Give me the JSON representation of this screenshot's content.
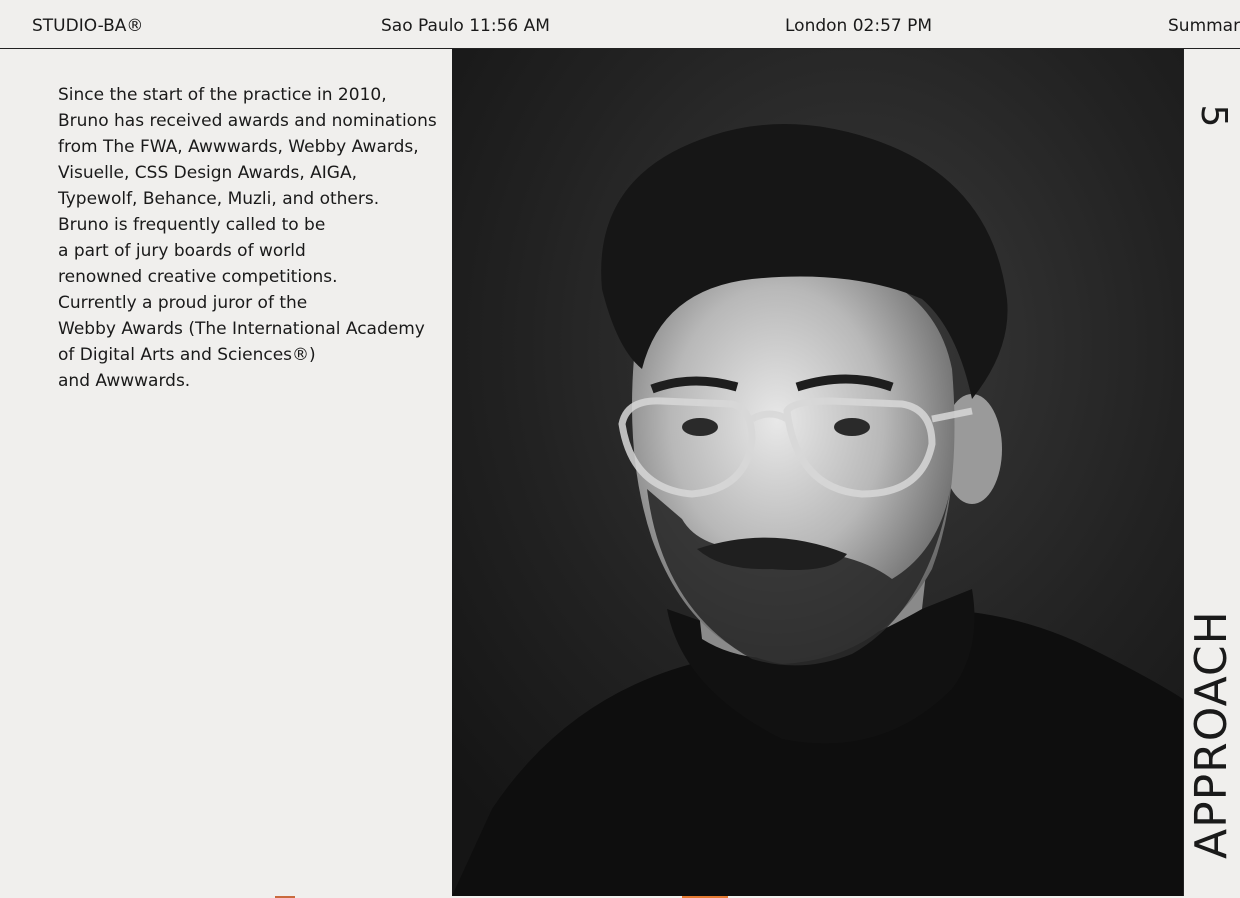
{
  "header": {
    "logo": "STUDIO-BA®",
    "city1": "Sao Paulo 11:56 AM",
    "city2": "London 02:57 PM",
    "summary": "Summary"
  },
  "bio": {
    "lines": [
      "Since the start of the practice in 2010,",
      "Bruno has received awards and nominations",
      "from The FWA, Awwwards, Webby Awards,",
      "Visuelle, CSS Design Awards, AIGA,",
      "Typewolf, Behance, Muzli, and others.",
      "Bruno is frequently called to be",
      "a part of jury boards of world",
      "renowned creative competitions.",
      "Currently a proud juror of the",
      "Webby Awards (The International Academy",
      "of Digital Arts and Sciences®)",
      "and Awwwards."
    ]
  },
  "photo": {
    "icon": "portrait-photo"
  },
  "section": {
    "number": "5",
    "label": "APPROACH"
  },
  "colors": {
    "background": "#f0efed",
    "text": "#1a1a1a",
    "photo_bg": "#1e1e1e"
  }
}
